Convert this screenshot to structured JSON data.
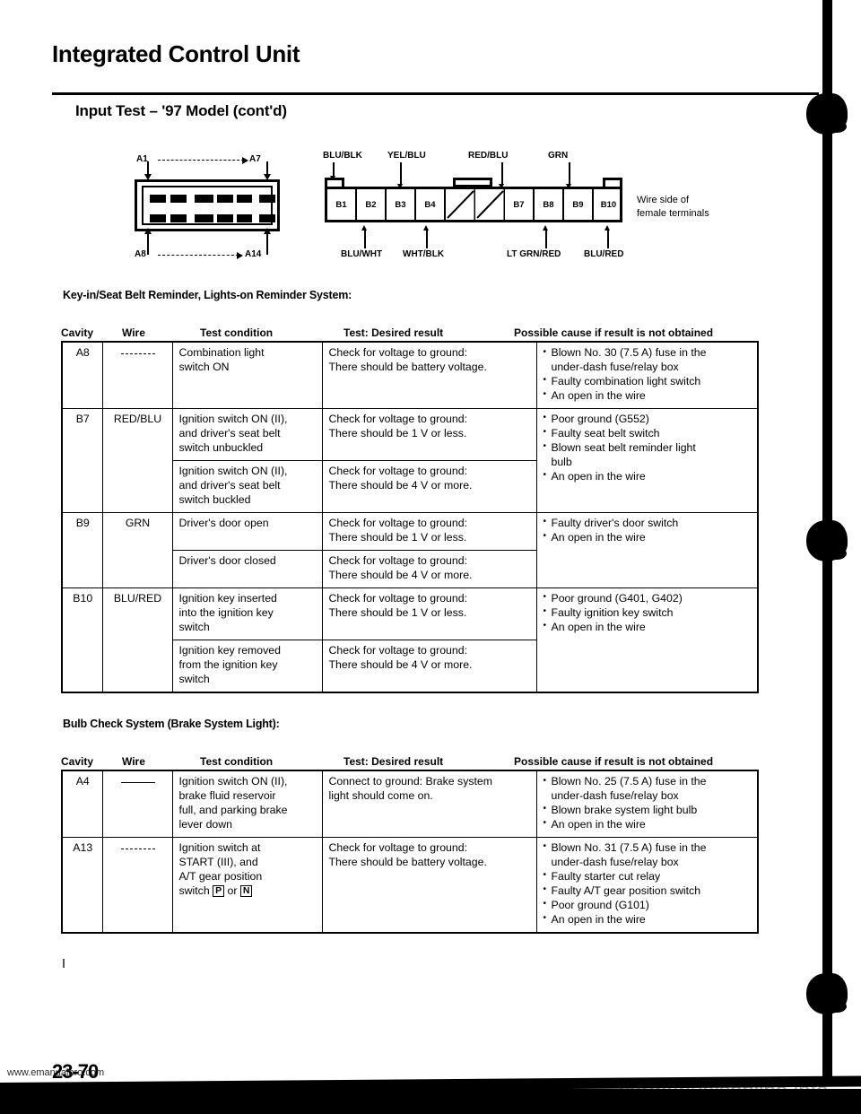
{
  "header": {
    "title": "Integrated Control Unit",
    "section": "Input Test – '97 Model (cont'd)"
  },
  "connector_a": {
    "label_top_left": "A1",
    "label_top_right": "A7",
    "label_bottom_left": "A8",
    "label_bottom_right": "A14"
  },
  "connector_b": {
    "top_labels": [
      "BLU/BLK",
      "YEL/BLU",
      "RED/BLU",
      "GRN"
    ],
    "bottom_labels": [
      "BLU/WHT",
      "WHT/BLK",
      "LT GRN/RED",
      "BLU/RED"
    ],
    "cavities": [
      "B1",
      "B2",
      "B3",
      "B4",
      "",
      "",
      "B7",
      "B8",
      "B9",
      "B10"
    ],
    "note_line1": "Wire side of",
    "note_line2": "female terminals"
  },
  "table1": {
    "caption": "Key-in/Seat Belt Reminder, Lights-on Reminder System:",
    "columns": [
      "Cavity",
      "Wire",
      "Test condition",
      "Test: Desired result",
      "Possible cause if result is not obtained"
    ],
    "groups": [
      {
        "cavity": "A8",
        "wire": "",
        "wire_style": "dash-dotted",
        "rows": [
          {
            "condition": "Combination light\nswitch ON",
            "result": "Check for voltage to ground:\nThere should be battery voltage."
          }
        ],
        "causes": [
          "Blown No. 30 (7.5 A) fuse in the",
          "under-dash fuse/relay box",
          "Faulty combination light switch",
          "An open in the wire"
        ],
        "cause_bullets": [
          true,
          false,
          true,
          true
        ]
      },
      {
        "cavity": "B7",
        "wire": "RED/BLU",
        "wire_style": "text",
        "rows": [
          {
            "condition": "Ignition switch ON (II),\nand driver's seat belt\nswitch unbuckled",
            "result": "Check for voltage to ground:\nThere should be 1 V or less."
          },
          {
            "condition": "Ignition switch ON (II),\nand driver's seat belt\nswitch buckled",
            "result": "Check for voltage to ground:\nThere should be 4 V or more."
          }
        ],
        "causes": [
          "Poor ground (G552)",
          "Faulty seat belt switch",
          "Blown seat belt reminder light",
          "bulb",
          "An open in the wire"
        ],
        "cause_bullets": [
          true,
          true,
          true,
          false,
          true
        ]
      },
      {
        "cavity": "B9",
        "wire": "GRN",
        "wire_style": "text",
        "rows": [
          {
            "condition": "Driver's door open",
            "result": "Check for voltage to ground:\nThere should be 1 V or less."
          },
          {
            "condition": "Driver's door closed",
            "result": "Check for voltage to ground:\nThere should be 4 V or more."
          }
        ],
        "causes": [
          "Faulty driver's door switch",
          "An open in the wire"
        ],
        "cause_bullets": [
          true,
          true
        ]
      },
      {
        "cavity": "B10",
        "wire": "BLU/RED",
        "wire_style": "text",
        "rows": [
          {
            "condition": "Ignition key inserted\ninto the ignition key\nswitch",
            "result": "Check for voltage to ground:\nThere should be 1 V or less."
          },
          {
            "condition": "Ignition key removed\nfrom the ignition key\nswitch",
            "result": "Check for voltage to ground:\nThere should be 4 V or more."
          }
        ],
        "causes": [
          "Poor ground (G401, G402)",
          "Faulty ignition key switch",
          "An open in the wire"
        ],
        "cause_bullets": [
          true,
          true,
          true
        ]
      }
    ]
  },
  "table2": {
    "caption": "Bulb Check System (Brake System Light):",
    "columns": [
      "Cavity",
      "Wire",
      "Test condition",
      "Test: Desired result",
      "Possible cause if result is not obtained"
    ],
    "groups": [
      {
        "cavity": "A4",
        "wire": "",
        "wire_style": "dash-solid",
        "rows": [
          {
            "condition": "Ignition switch ON (II),\nbrake fluid reservoir\nfull, and parking brake\nlever down",
            "result": "Connect to ground: Brake system\nlight should come on."
          }
        ],
        "causes": [
          "Blown No. 25 (7.5 A) fuse in the",
          "under-dash fuse/relay box",
          "Blown brake system light bulb",
          "An open in the wire"
        ],
        "cause_bullets": [
          true,
          false,
          true,
          true
        ]
      },
      {
        "cavity": "A13",
        "wire": "",
        "wire_style": "dash-dotted",
        "rows": [
          {
            "condition_html": "Ignition switch at<br>START (III), and<br>A/T gear position<br>switch <span class=\"boxglyph\">P</span> or <span class=\"boxglyph\">N</span>",
            "result": "Check for voltage to ground:\nThere should be battery voltage."
          }
        ],
        "causes": [
          "Blown No. 31 (7.5 A) fuse in the",
          "under-dash fuse/relay box",
          "Faulty starter cut relay",
          "Faulty A/T gear position switch",
          "Poor ground (G101)",
          "An open in the wire"
        ],
        "cause_bullets": [
          true,
          false,
          true,
          true,
          true,
          true
        ]
      }
    ]
  },
  "footer": {
    "page_number": "23-70",
    "watermark_left": "www.emanualpro.com",
    "watermark_right": "carmanualsonline.info"
  }
}
